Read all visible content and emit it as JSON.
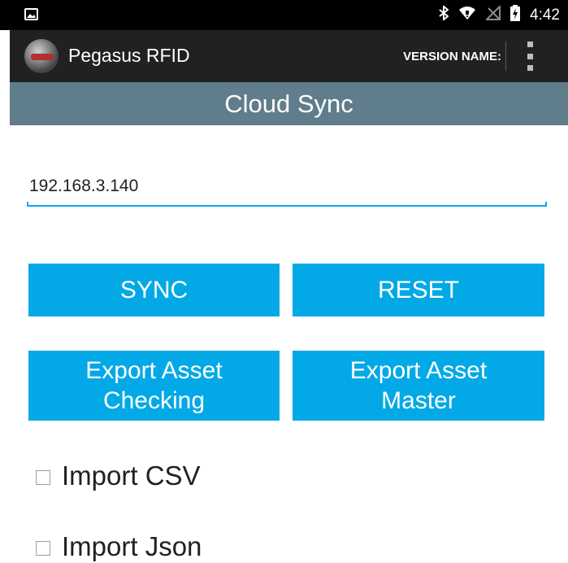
{
  "status_bar": {
    "time": "4:42",
    "icons": [
      "image-icon",
      "bluetooth-icon",
      "wifi-icon",
      "no-signal-icon",
      "battery-charging-icon"
    ]
  },
  "app_bar": {
    "title": "Pegasus RFID",
    "version_label": "VERSION NAME:",
    "menu_icon": "overflow-menu-icon"
  },
  "title_bar": {
    "title": "Cloud Sync"
  },
  "ip_field": {
    "value": "192.168.3.140"
  },
  "buttons": {
    "sync": "SYNC",
    "reset": "RESET",
    "export_checking_line1": "Export Asset",
    "export_checking_line2": "Checking",
    "export_master_line1": "Export Asset",
    "export_master_line2": "Master"
  },
  "checkboxes": {
    "import_csv": {
      "label": "Import CSV",
      "checked": false
    },
    "import_json": {
      "label": "Import Json",
      "checked": false
    }
  },
  "colors": {
    "status_bar": "#000000",
    "app_bar": "#212121",
    "title_bar": "#607d8b",
    "accent": "#03a9e6",
    "input_underline": "#03a9f4"
  }
}
